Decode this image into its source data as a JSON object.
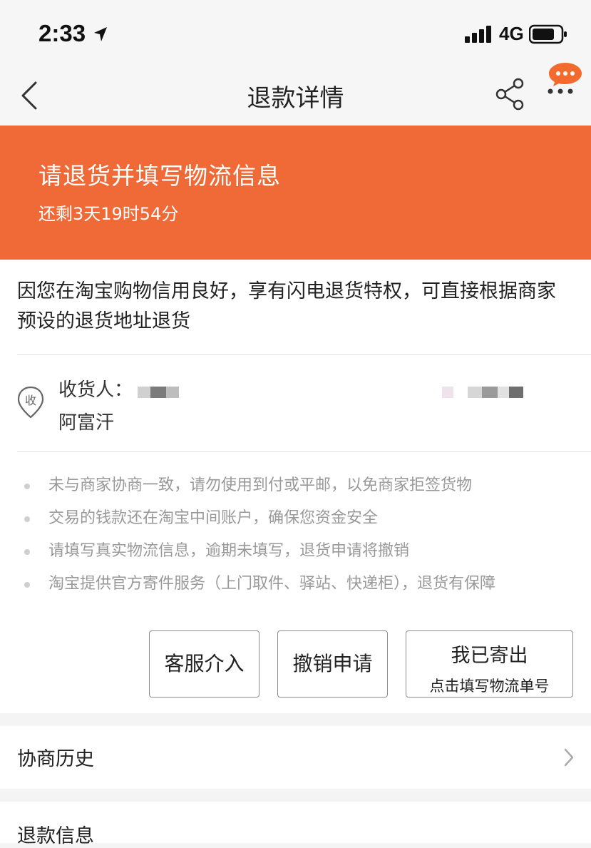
{
  "status_bar": {
    "time": "2:33",
    "network": "4G"
  },
  "nav": {
    "title": "退款详情"
  },
  "banner": {
    "title": "请退货并填写物流信息",
    "countdown": "还剩3天19时54分",
    "color": "#ef6a37"
  },
  "card": {
    "privilege_text": "因您在淘宝购物信用良好，享有闪电退货特权，可直接根据商家预设的退货地址退货",
    "receive_icon_char": "收",
    "receiver_label": "收货人：",
    "receiver_name": "阿富汗",
    "tips": [
      "未与商家协商一致，请勿使用到付或平邮，以免商家拒签货物",
      "交易的钱款还在淘宝中间账户，确保您资金安全",
      "请填写真实物流信息，逾期未填写，退货申请将撤销",
      "淘宝提供官方寄件服务（上门取件、驿站、快递柜），退货有保障"
    ],
    "buttons": {
      "customer_service": "客服介入",
      "cancel_request": "撤销申请",
      "shipped_title": "我已寄出",
      "shipped_subtitle": "点击填写物流单号"
    }
  },
  "rows": {
    "history": "协商历史",
    "refund_info": "退款信息"
  },
  "icons": [
    "location-arrow-icon",
    "signal-icon",
    "battery-icon",
    "back-icon",
    "share-icon",
    "message-bubble-icon",
    "more-icon",
    "receive-icon",
    "chevron-right-icon"
  ]
}
